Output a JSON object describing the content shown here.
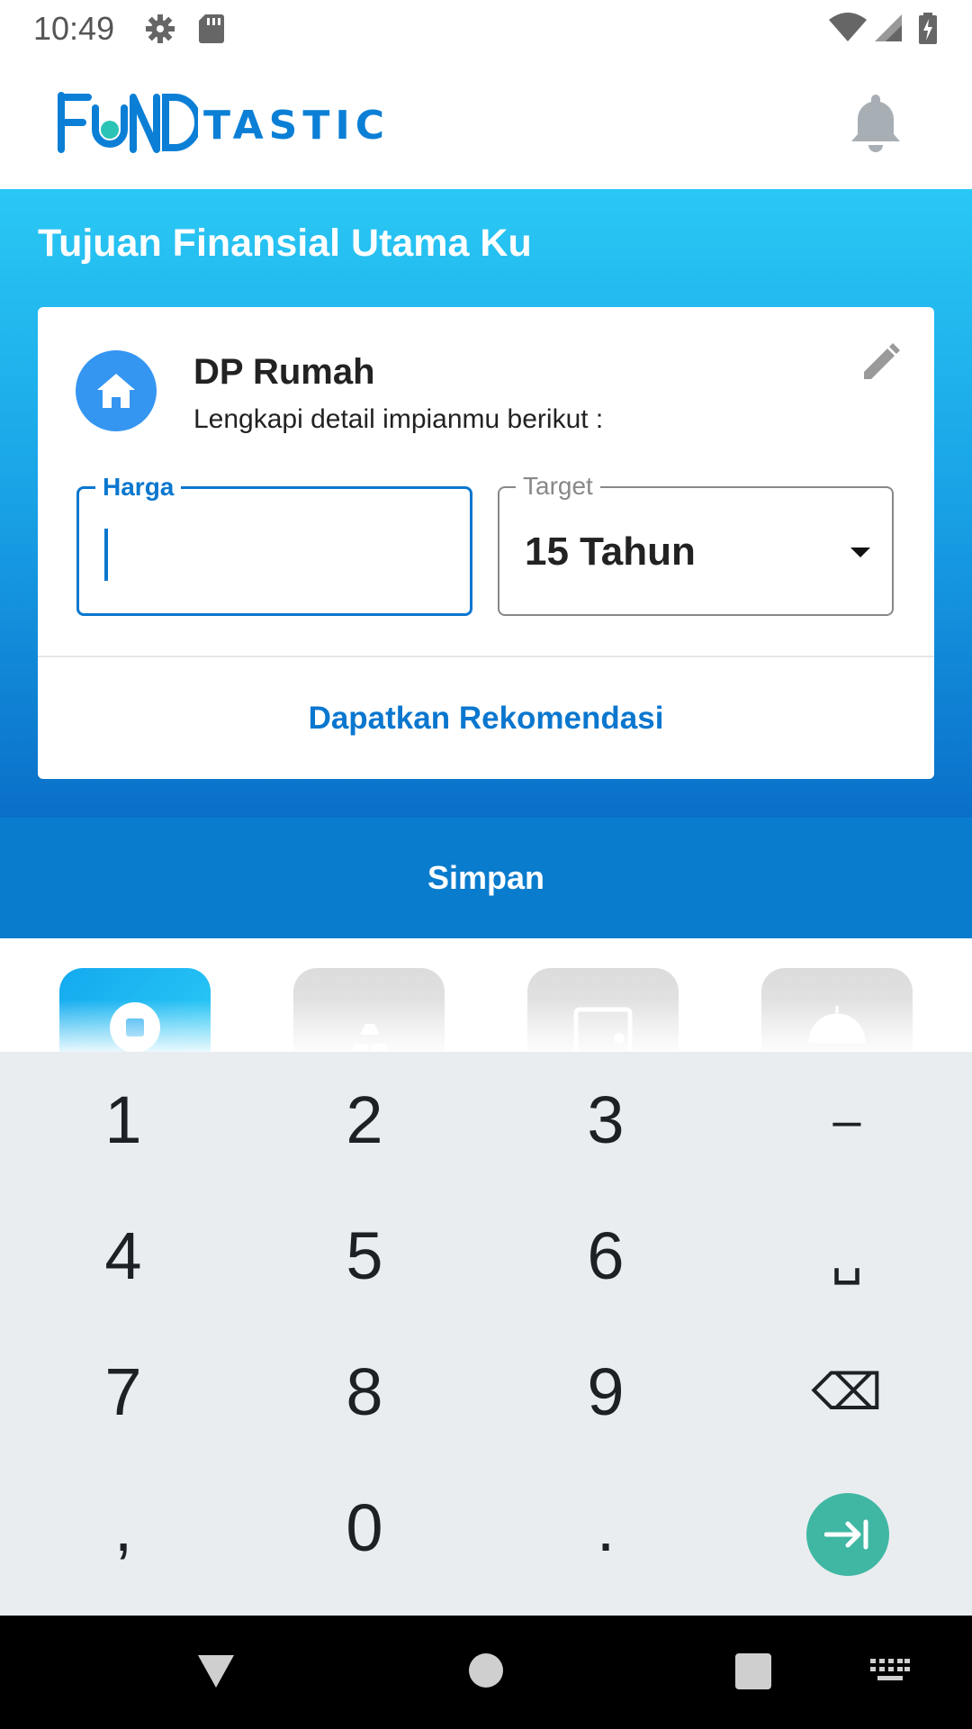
{
  "status_bar": {
    "time": "10:49",
    "icons": [
      "gear-icon",
      "sd-card-icon",
      "wifi-icon",
      "signal-icon",
      "battery-charging-icon"
    ]
  },
  "app_bar": {
    "logo_text": "FUNDTASTIC",
    "logo_tail": "TASTIC",
    "notification_icon": "bell-icon"
  },
  "hero": {
    "title": "Tujuan Finansial Utama Ku"
  },
  "goal_card": {
    "icon": "home-icon",
    "title": "DP Rumah",
    "subtitle": "Lengkapi detail impianmu berikut :",
    "edit_icon": "pencil-icon",
    "price_field": {
      "label": "Harga",
      "value": ""
    },
    "target_field": {
      "label": "Target",
      "value": "15 Tahun"
    },
    "recommend_button": "Dapatkan Rekomendasi"
  },
  "save_button": "Simpan",
  "categories": [
    {
      "icon": "home-icon",
      "active": true
    },
    {
      "icon": "gold-bars-icon",
      "active": false
    },
    {
      "icon": "wallet-icon",
      "active": false
    },
    {
      "icon": "umbrella-icon",
      "active": false
    }
  ],
  "keyboard": {
    "rows": [
      [
        "1",
        "2",
        "3",
        "–"
      ],
      [
        "4",
        "5",
        "6",
        "␣"
      ],
      [
        "7",
        "8",
        "9",
        "⌫"
      ],
      [
        ",",
        "0",
        ".",
        "→|"
      ]
    ]
  },
  "nav_bar": {
    "icons": [
      "back-icon",
      "home-circle-icon",
      "recents-icon",
      "keyboard-icon"
    ]
  },
  "colors": {
    "brand_blue": "#0a77cf",
    "hero_top": "#2ac8f4",
    "hero_bottom": "#0a6fc9",
    "enter_key": "#3fb7a3"
  }
}
